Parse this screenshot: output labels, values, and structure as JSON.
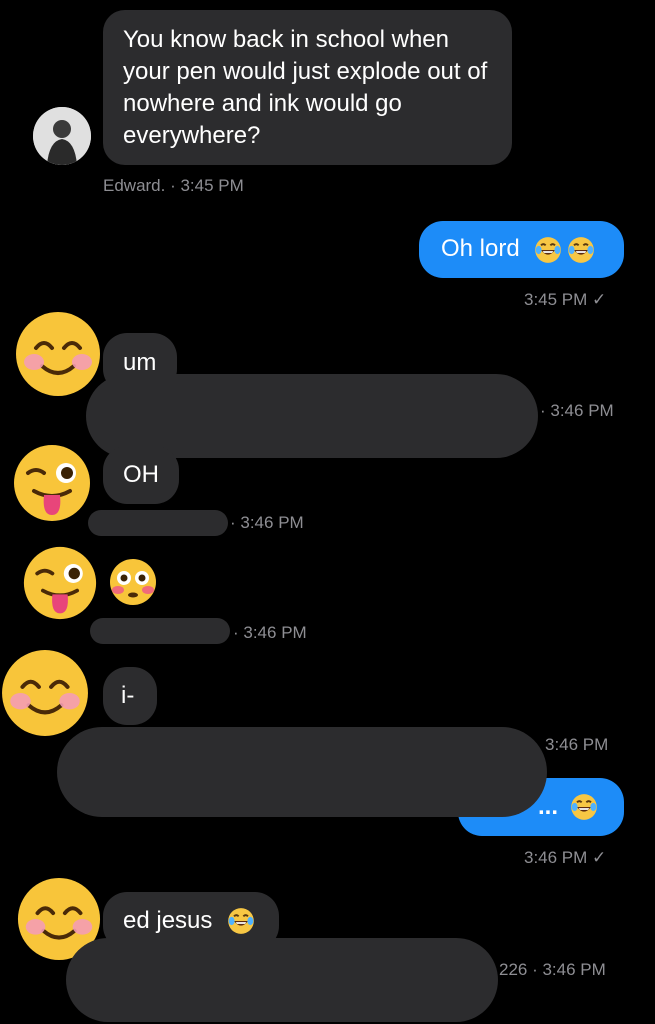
{
  "messages": {
    "m1": {
      "text": "You know back in school when your pen would just explode out of nowhere and ink would go everywhere?",
      "meta": "Edward. · 3:45 PM"
    },
    "m2": {
      "text": "Oh lord",
      "meta": "3:45 PM ✓"
    },
    "m3": {
      "text": "um",
      "meta": "· 3:46 PM"
    },
    "m4": {
      "text": "OH",
      "meta": "· 3:46 PM"
    },
    "m5": {
      "meta": "· 3:46 PM"
    },
    "m6": {
      "text": "i-",
      "meta": "3:46 PM"
    },
    "m7": {
      "text": "... ",
      "meta": "3:46 PM ✓"
    },
    "m8": {
      "text": "ed jesus",
      "meta": "226 · 3:46 PM"
    }
  },
  "icons": {
    "avatar": "user-photo-avatar",
    "smile": "smiling-face-icon",
    "wink": "winking-tongue-face-icon",
    "flushed": "flushed-face-icon",
    "laugh": "tears-of-joy-icon"
  },
  "colors": {
    "background": "#000000",
    "incoming_bubble": "#2c2c2e",
    "outgoing_bubble": "#1d8cf8",
    "meta_text": "#8e8e93"
  }
}
